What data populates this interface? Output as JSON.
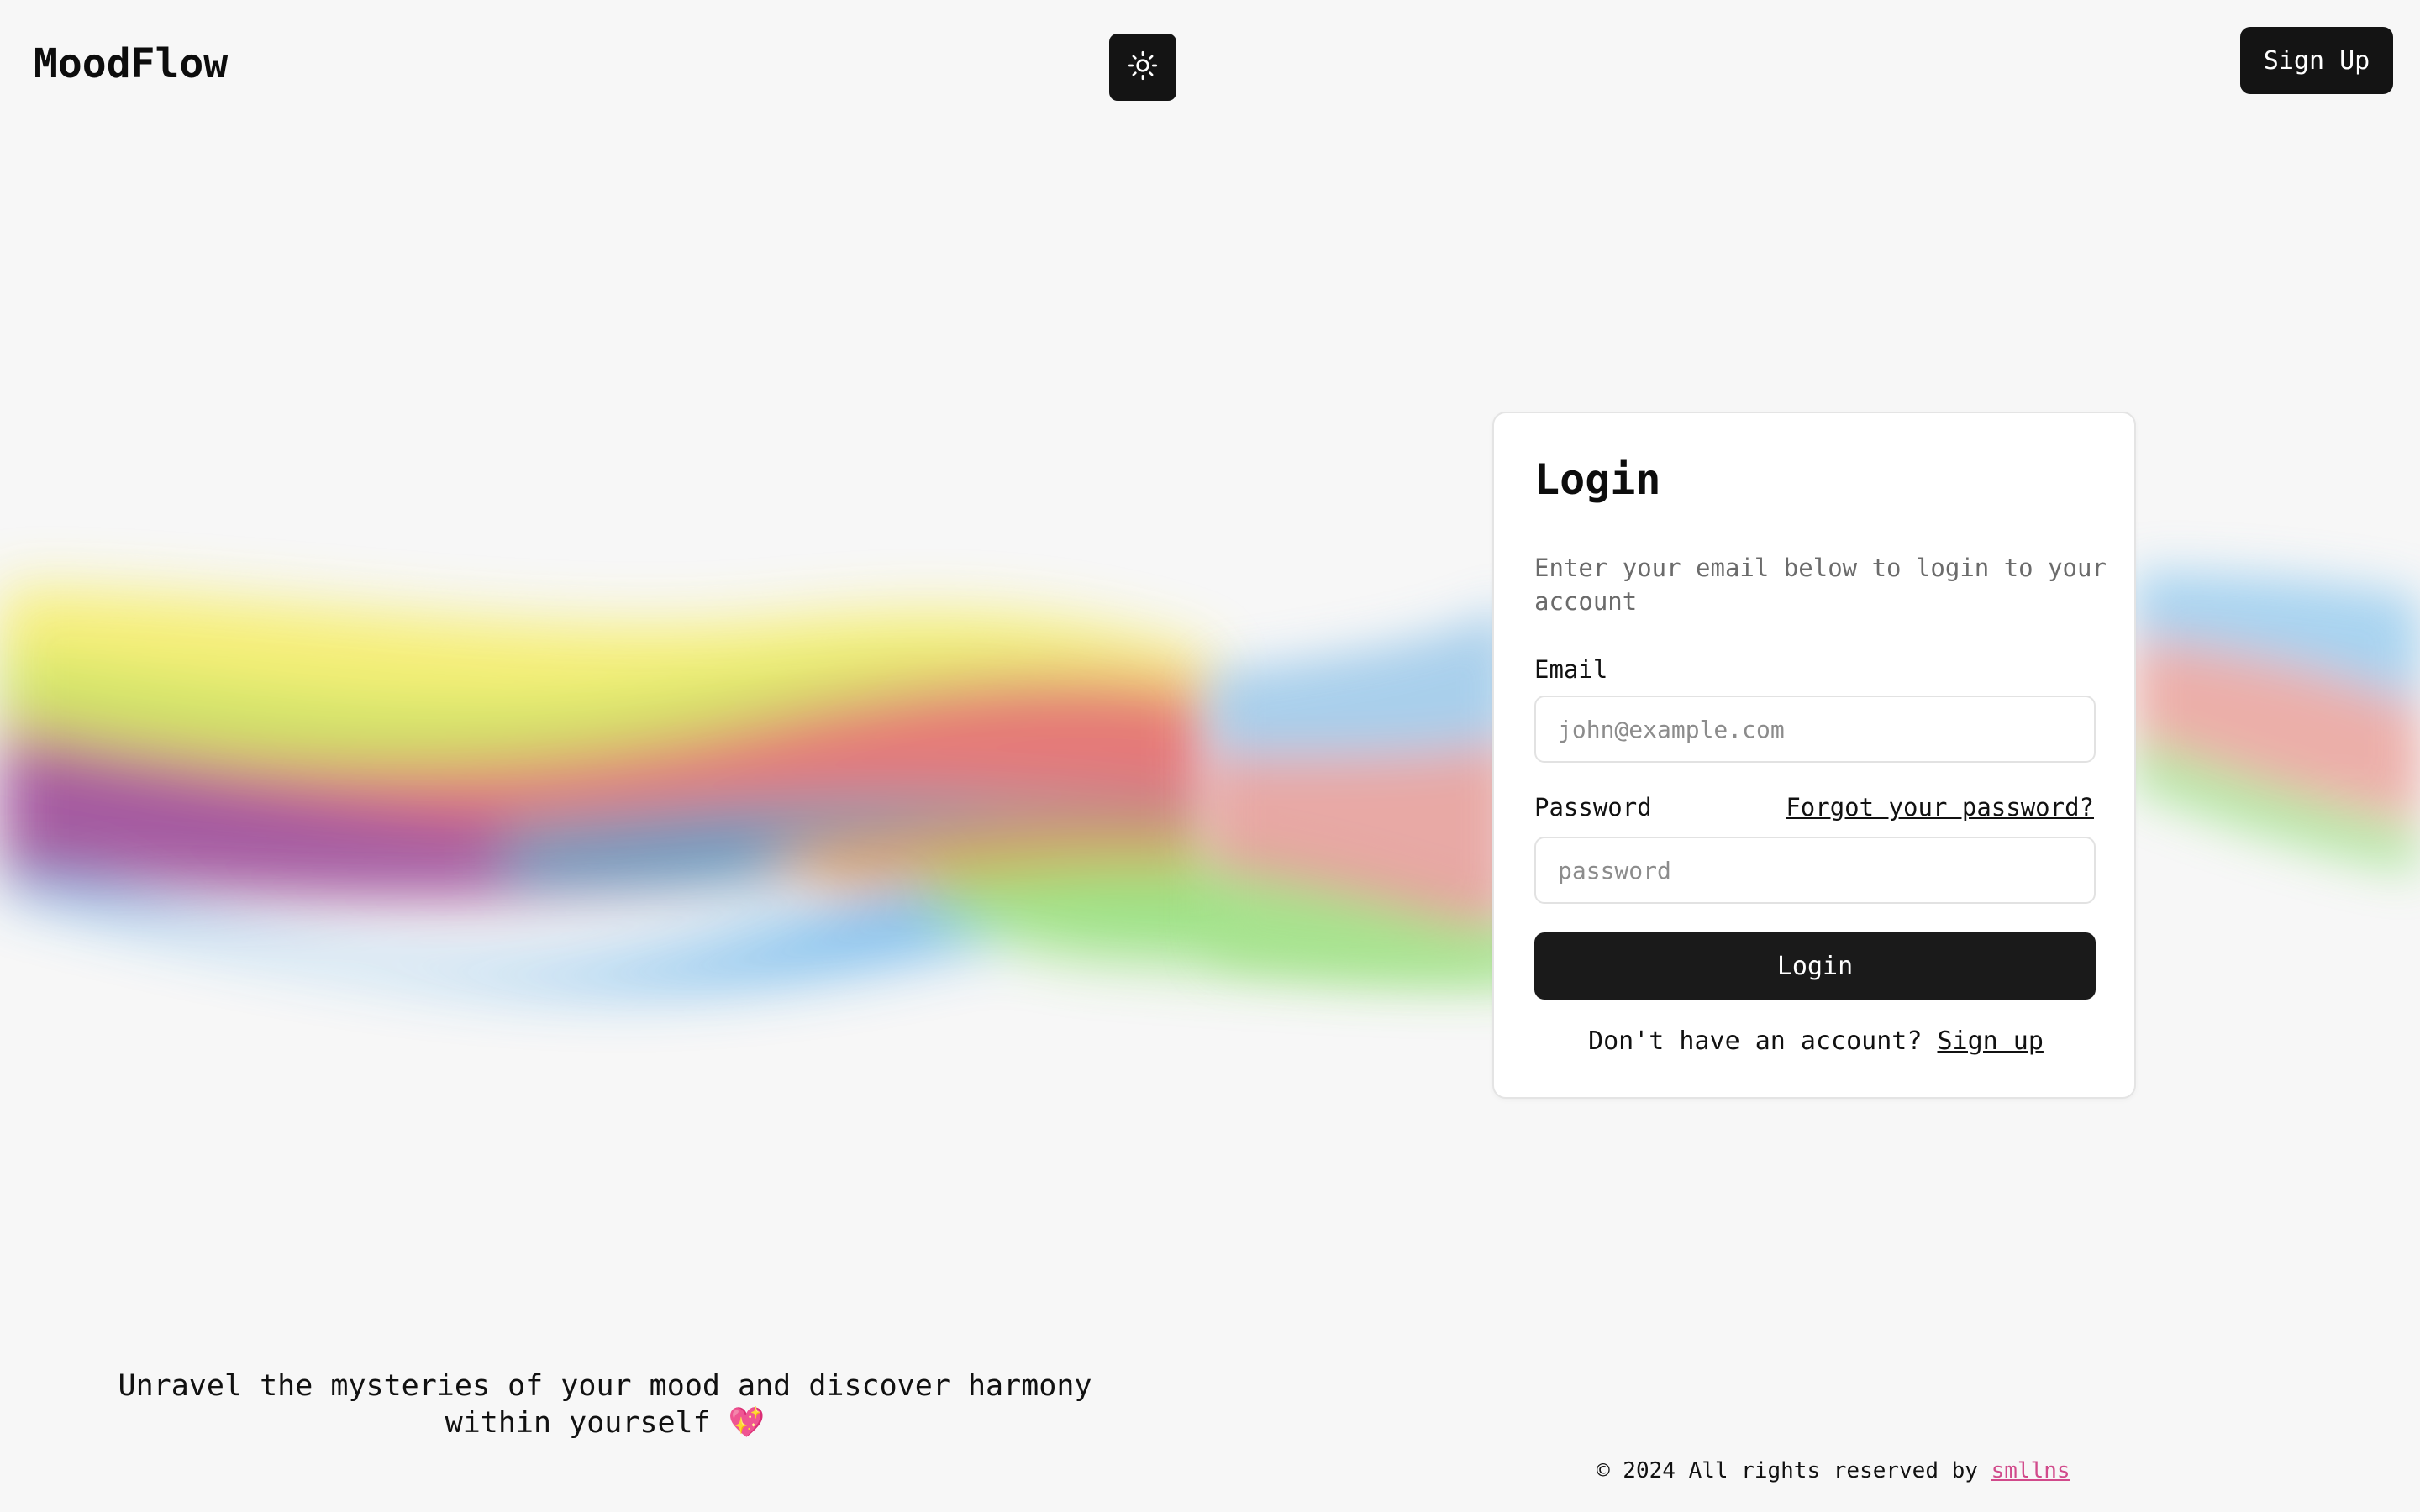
{
  "header": {
    "logo": "MoodFlow",
    "theme_icon": "sun-icon",
    "signup_label": "Sign Up"
  },
  "login": {
    "title": "Login",
    "description": "Enter your email below to login to your account",
    "email_label": "Email",
    "email_placeholder": "john@example.com",
    "password_label": "Password",
    "password_placeholder": "password",
    "forgot_label": "Forgot your password?",
    "submit_label": "Login",
    "no_account_text": "Don't have an account?",
    "signup_link": "Sign up"
  },
  "footer": {
    "tagline": "Unravel the mysteries of your mood and discover harmony within yourself 💖",
    "copyright_prefix": "© 2024 All rights reserved by",
    "author": "smllns"
  },
  "colors": {
    "background": "#f7f7f7",
    "primary": "#141414",
    "author_link": "#d14a8b"
  }
}
